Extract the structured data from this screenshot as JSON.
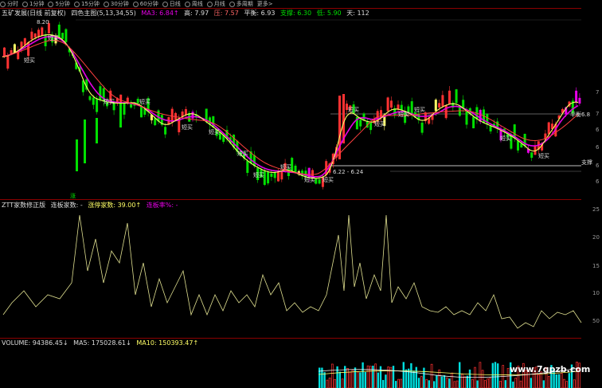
{
  "toolbar": {
    "tabs": [
      "分时",
      "1分钟",
      "5分钟",
      "15分钟",
      "30分钟",
      "60分钟",
      "日线",
      "周线",
      "月线",
      "多周期",
      "更多>"
    ]
  },
  "main": {
    "title": "五矿发展(日线 前复权)",
    "indicator": "四色主图(5,13,34,55)",
    "ma3": "MA3: 6.84↑",
    "high": "高: 7.97",
    "pressure": "压: 7.57",
    "balance": "平衡: 6.93",
    "support": "支撑: 6.30",
    "low": "低: 5.90",
    "day": "天: 112",
    "peak_label": "8.20",
    "range_label": "6.22 - 6.24",
    "balance_tag": "平衡6.8",
    "support_tag": "支撑",
    "buy_label": "短买",
    "day_tag": "涨",
    "y_ticks": [
      "7",
      "7",
      "6",
      "6",
      "6",
      "6"
    ]
  },
  "indicator_panel": {
    "name": "ZTT家数修正版",
    "field1": "连板家数: -",
    "field2": "涨停家数: 39.00↑",
    "field3": "连板率%: -",
    "y_ticks": [
      "25",
      "20",
      "15",
      "10",
      "50"
    ]
  },
  "volume_panel": {
    "label": "VOLUME: 94386.45↓",
    "ma5": "MA5: 175028.61↓",
    "ma10": "MA10: 150393.47↑"
  },
  "watermark": "www.7gpzb.com",
  "colors": {
    "up": "#ff3232",
    "down": "#00e000",
    "magenta": "#e600e6",
    "yellow": "#ffff66",
    "cyan": "#00dede",
    "dark_red": "#8a0000"
  },
  "chart_data": [
    {
      "type": "candlestick",
      "title": "五矿发展(日线 前复权)",
      "series": [
        {
          "name": "MA3"
        }
      ],
      "annotations": [
        "8.20",
        "6.22 - 6.24",
        "平衡6.8",
        "支撑"
      ],
      "levels": {
        "high": 7.97,
        "pressure": 7.57,
        "balance": 6.93,
        "support": 6.3,
        "low": 5.9
      }
    },
    {
      "type": "line",
      "title": "ZTT家数修正版",
      "series": [
        {
          "name": "涨停家数",
          "last": 39.0
        }
      ],
      "y_ticks": [
        25,
        20,
        15,
        10,
        50
      ]
    },
    {
      "type": "bar",
      "title": "VOLUME",
      "series": [
        {
          "name": "VOLUME",
          "last": 94386.45
        },
        {
          "name": "MA5",
          "last": 175028.61
        },
        {
          "name": "MA10",
          "last": 150393.47
        }
      ]
    }
  ]
}
